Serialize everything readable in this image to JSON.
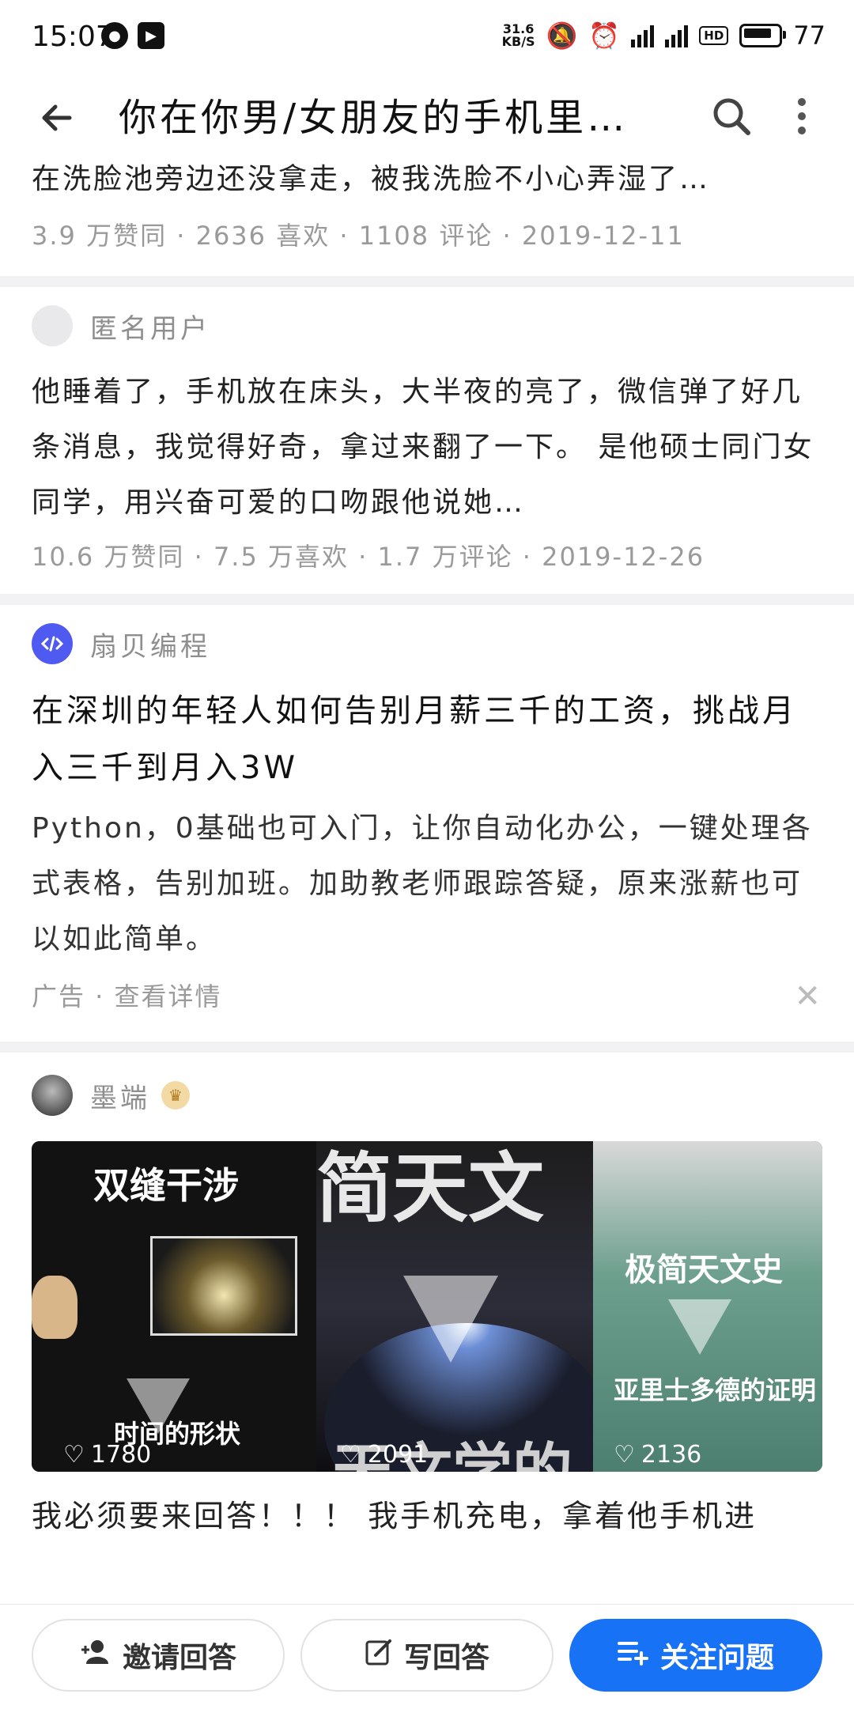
{
  "status_bar": {
    "time": "15:07",
    "net_speed": "31.6",
    "net_unit": "KB/S",
    "battery": "77"
  },
  "header": {
    "title": "你在你男/女朋友的手机里发现过什么？"
  },
  "answer1": {
    "excerpt_tail": "在洗脸池旁边还没拿走，被我洗脸不小心弄湿了…",
    "meta": "3.9 万赞同 · 2636 喜欢 · 1108 评论 · 2019-12-11"
  },
  "answer2": {
    "author": "匿名用户",
    "excerpt": "他睡着了，手机放在床头，大半夜的亮了，微信弹了好几条消息，我觉得好奇，拿过来翻了一下。 是他硕士同门女同学，用兴奋可爱的口吻跟他说她…",
    "meta": "10.6 万赞同 · 7.5 万喜欢 · 1.7 万评论 · 2019-12-26"
  },
  "ad": {
    "brand": "扇贝编程",
    "title": "在深圳的年轻人如何告别月薪三千的工资，挑战月入三千到月入3W",
    "desc": "Python，0基础也可入门，让你自动化办公，一键处理各式表格，告别加班。加助教老师跟踪答疑，原来涨薪也可以如此简单。",
    "label": "广告 · 查看详情"
  },
  "answer3": {
    "author": "墨端",
    "media": {
      "panel1_title": "双缝干涉",
      "panel1_caption": "时间的形状",
      "panel1_likes": "1780",
      "panel2_title": "简天文",
      "panel2_bottom": "天文学的",
      "panel2_likes": "2091",
      "panel3_title": "极简天文史",
      "panel3_sub": "亚里士多德的证明",
      "panel3_likes": "2136"
    },
    "excerpt": "我必须要来回答！！！ 我手机充电，拿着他手机进"
  },
  "bottom_bar": {
    "invite": "邀请回答",
    "write": "写回答",
    "follow": "关注问题"
  }
}
